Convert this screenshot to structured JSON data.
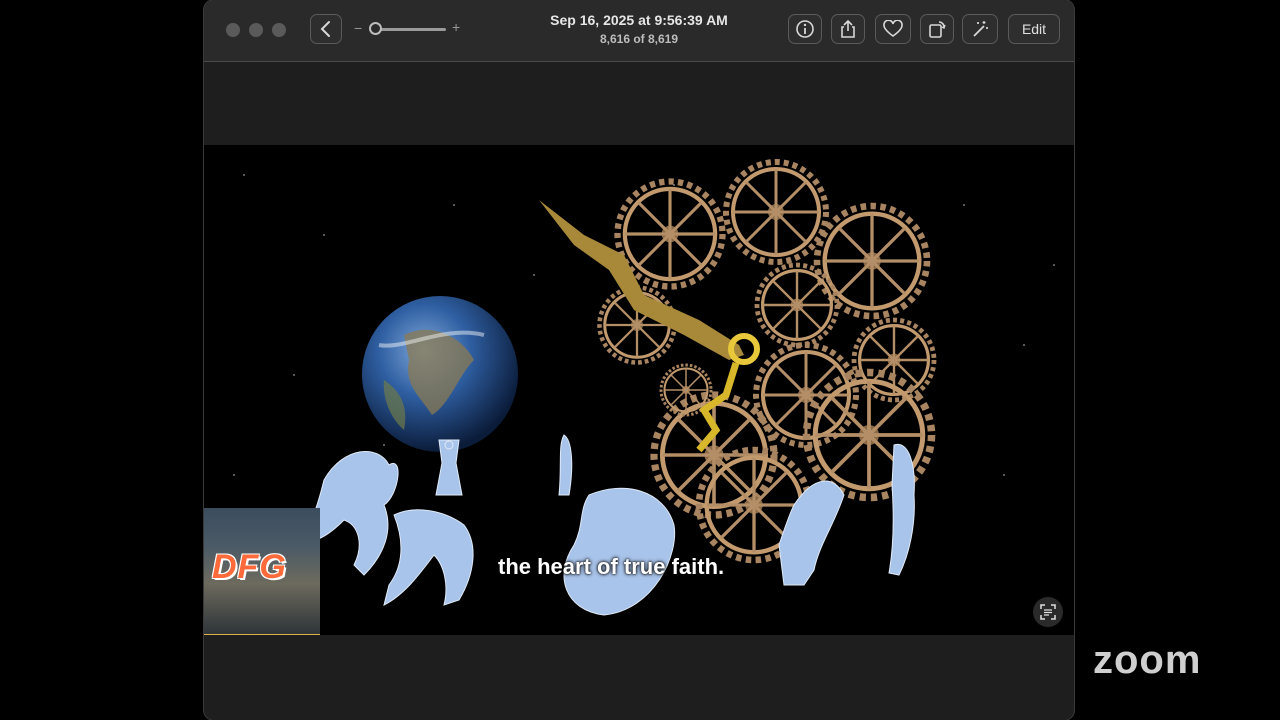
{
  "window": {
    "date": "Sep 16, 2025 at 9:56:39 AM",
    "count": "8,616 of 8,619",
    "zoom_minus": "−",
    "zoom_plus": "+",
    "edit_label": "Edit"
  },
  "icons": {
    "back": "chevron-left-icon",
    "info": "info-icon",
    "share": "share-icon",
    "favorite": "heart-icon",
    "rotate": "rotate-icon",
    "enhance": "magic-wand-icon",
    "live_text": "live-text-icon"
  },
  "video": {
    "subtitle": "the heart of true faith.",
    "thumb_logo": "DFG"
  },
  "brand": {
    "zoom": "zoom"
  },
  "colors": {
    "titlebar": "#2a2a2a",
    "window": "#1e1e1e",
    "accent_logo": "#ff6a3a"
  }
}
